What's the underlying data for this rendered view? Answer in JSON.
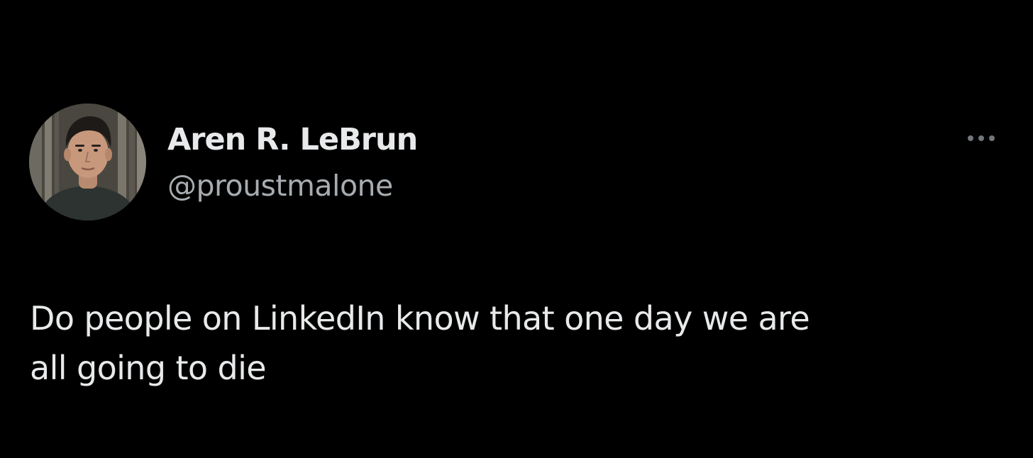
{
  "tweet": {
    "author": {
      "display_name": "Aren R. LeBrun",
      "handle": "@proustmalone",
      "avatar_icon": "profile-photo"
    },
    "more_icon": "more-options-icon",
    "text_lines": [
      "Do people on LinkedIn know that one day we are",
      "all going to die"
    ]
  },
  "colors": {
    "background": "#000000",
    "primary_text": "#e7e9ea",
    "secondary_text": "#a7acb0",
    "icon_muted": "#71767b"
  }
}
